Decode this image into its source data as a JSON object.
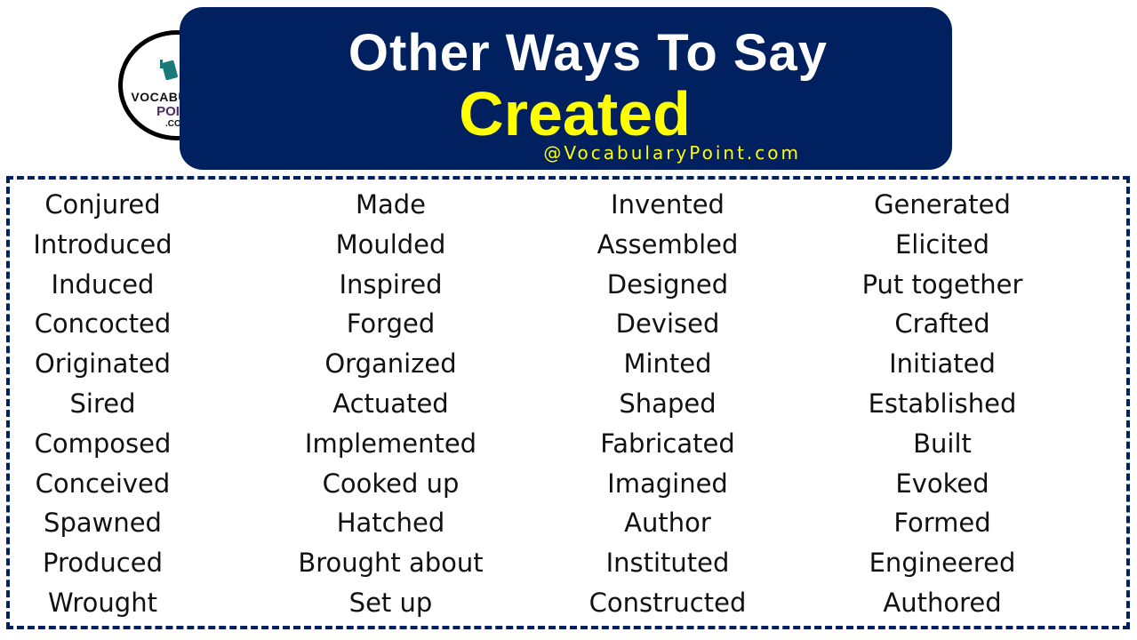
{
  "header": {
    "title_line1": "Other Ways To Say",
    "title_line2": "Created",
    "site_handle": "@VocabularyPoint.com",
    "colors": {
      "banner": "#002060",
      "title": "#ffffff",
      "keyword": "#ffff00"
    }
  },
  "logo": {
    "line1": "VOCABULARY",
    "line2": "POINT",
    "line3": ".COM",
    "icon": "mascot-with-book-icon"
  },
  "columns": [
    [
      "Conjured",
      "Introduced",
      "Induced",
      "Concocted",
      "Originated",
      "Sired",
      "Composed",
      "Conceived",
      "Spawned",
      "Produced",
      "Wrought"
    ],
    [
      "Made",
      "Moulded",
      "Inspired",
      "Forged",
      "Organized",
      "Actuated",
      "Implemented",
      "Cooked up",
      "Hatched",
      "Brought about",
      "Set up"
    ],
    [
      "Invented",
      "Assembled",
      "Designed",
      "Devised",
      "Minted",
      "Shaped",
      "Fabricated",
      "Imagined",
      "Author",
      "Instituted",
      "Constructed"
    ],
    [
      "Generated",
      "Elicited",
      "Put together",
      "Crafted",
      "Initiated",
      "Established",
      "Built",
      "Evoked",
      "Formed",
      "Engineered",
      "Authored"
    ]
  ]
}
